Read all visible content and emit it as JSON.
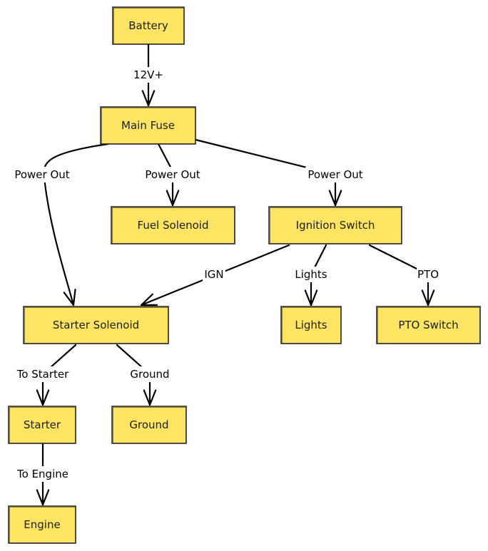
{
  "diagram": {
    "type": "flowchart",
    "node_fill": "#fde563",
    "node_stroke": "#2b2b2b",
    "nodes": [
      {
        "id": "battery",
        "label": "Battery"
      },
      {
        "id": "main_fuse",
        "label": "Main Fuse"
      },
      {
        "id": "fuel_solenoid",
        "label": "Fuel Solenoid"
      },
      {
        "id": "ignition_switch",
        "label": "Ignition Switch"
      },
      {
        "id": "starter_solenoid",
        "label": "Starter Solenoid"
      },
      {
        "id": "lights",
        "label": "Lights"
      },
      {
        "id": "pto_switch",
        "label": "PTO Switch"
      },
      {
        "id": "starter",
        "label": "Starter"
      },
      {
        "id": "ground",
        "label": "Ground"
      },
      {
        "id": "engine",
        "label": "Engine"
      }
    ],
    "edges": [
      {
        "from": "battery",
        "to": "main_fuse",
        "label": "12V+"
      },
      {
        "from": "main_fuse",
        "to": "starter_solenoid",
        "label": "Power Out"
      },
      {
        "from": "main_fuse",
        "to": "fuel_solenoid",
        "label": "Power Out"
      },
      {
        "from": "main_fuse",
        "to": "ignition_switch",
        "label": "Power Out"
      },
      {
        "from": "ignition_switch",
        "to": "starter_solenoid",
        "label": "IGN"
      },
      {
        "from": "ignition_switch",
        "to": "lights",
        "label": "Lights"
      },
      {
        "from": "ignition_switch",
        "to": "pto_switch",
        "label": "PTO"
      },
      {
        "from": "starter_solenoid",
        "to": "starter",
        "label": "To Starter"
      },
      {
        "from": "starter_solenoid",
        "to": "ground",
        "label": "Ground"
      },
      {
        "from": "starter",
        "to": "engine",
        "label": "To Engine"
      }
    ]
  }
}
